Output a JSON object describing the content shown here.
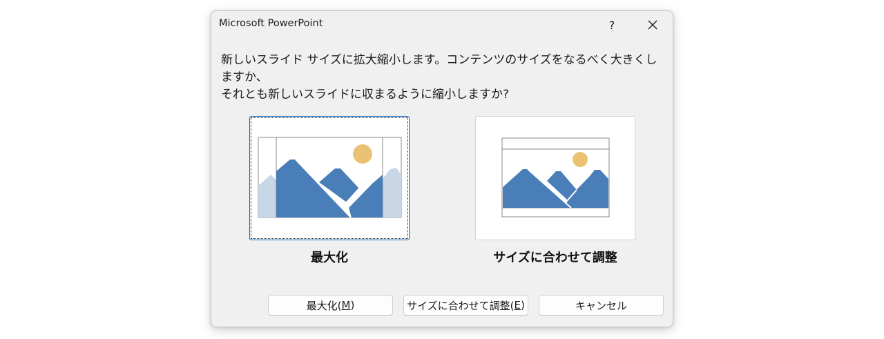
{
  "dialog": {
    "title": "Microsoft PowerPoint",
    "help_label": "?",
    "message_line1": "新しいスライド サイズに拡大縮小します。コンテンツのサイズをなるべく大きくしますか、",
    "message_line2": "それとも新しいスライドに収まるように縮小しますか?"
  },
  "options": {
    "maximize_label": "最大化",
    "fit_label": "サイズに合わせて調整"
  },
  "buttons": {
    "maximize_text": "最大化(",
    "maximize_key": "M",
    "maximize_close": ")",
    "fit_text": "サイズに合わせて調整(",
    "fit_key": "E",
    "fit_close": ")",
    "cancel": "キャンセル"
  },
  "colors": {
    "mountain": "#4a7eb8",
    "mountain_faded": "#c9d6e6",
    "sun": "#ebc274",
    "frame": "#8a8a8a",
    "focus_border": "#0a63b8"
  },
  "icons": {
    "close": "close-icon",
    "help": "help-icon"
  }
}
